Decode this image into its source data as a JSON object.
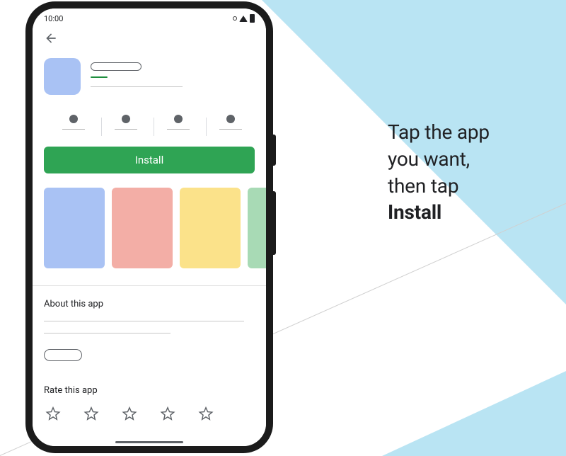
{
  "status": {
    "time": "10:00"
  },
  "button": {
    "install": "Install"
  },
  "sections": {
    "about": "About this app",
    "rate": "Rate this app"
  },
  "caption": {
    "line1": "Tap the app",
    "line2": "you want,",
    "line3": "then tap",
    "line4": "Install"
  },
  "colors": {
    "install_bg": "#2fa454",
    "accent_bg": "#b9e4f3",
    "shot_blue": "#a9c2f4",
    "shot_red": "#f3aea6",
    "shot_yellow": "#fbe28a",
    "shot_green": "#a8dab5"
  }
}
